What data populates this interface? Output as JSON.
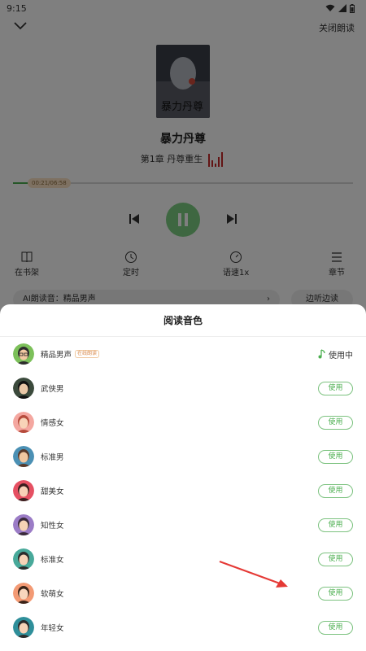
{
  "status": {
    "time": "9:15"
  },
  "header": {
    "close_reading": "关闭朗读"
  },
  "book": {
    "title": "暴力丹尊",
    "chapter": "第1章 丹尊重生",
    "cover_text": "暴力丹尊"
  },
  "progress": {
    "time_label": "00:21/06:58",
    "fraction": 0.05
  },
  "functions": {
    "bookshelf": "在书架",
    "timer": "定时",
    "speed": "语速1x",
    "chapters": "章节"
  },
  "ai_voice": {
    "label": "AI朗读音：精品男声"
  },
  "listen_button": "边听边读",
  "sheet": {
    "title": "阅读音色",
    "in_use_label": "使用中",
    "use_label": "使用",
    "online_tag": "在线朗读",
    "voices": [
      {
        "name": "精品男声",
        "avatar": "man-glasses-avatar",
        "active": true
      },
      {
        "name": "武侠男",
        "avatar": "wuxia-man-avatar"
      },
      {
        "name": "情感女",
        "avatar": "emotional-woman-avatar"
      },
      {
        "name": "标准男",
        "avatar": "standard-man-avatar"
      },
      {
        "name": "甜美女",
        "avatar": "sweet-woman-avatar"
      },
      {
        "name": "知性女",
        "avatar": "intellectual-woman-avatar"
      },
      {
        "name": "标准女",
        "avatar": "standard-woman-avatar"
      },
      {
        "name": "软萌女",
        "avatar": "cute-woman-avatar"
      },
      {
        "name": "年轻女",
        "avatar": "young-woman-avatar"
      }
    ]
  },
  "colors": {
    "accent": "#4caf50",
    "accent_border": "#7cc27f",
    "annotation": "#e53935"
  }
}
